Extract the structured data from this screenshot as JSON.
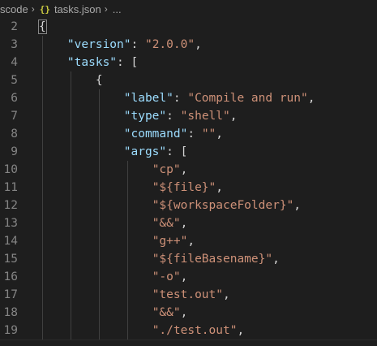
{
  "breadcrumb": {
    "folder": "scode",
    "file_icon": "{}",
    "file": "tasks.json",
    "ellipsis": "..."
  },
  "editor": {
    "lines": [
      {
        "n": "2",
        "tokens": [
          {
            "t": "{",
            "c": "punc"
          }
        ]
      },
      {
        "n": "3",
        "tokens": [
          {
            "t": "    "
          },
          {
            "t": "\"version\"",
            "c": "key"
          },
          {
            "t": ": "
          },
          {
            "t": "\"2.0.0\"",
            "c": "str"
          },
          {
            "t": ","
          }
        ]
      },
      {
        "n": "4",
        "tokens": [
          {
            "t": "    "
          },
          {
            "t": "\"tasks\"",
            "c": "key"
          },
          {
            "t": ": ["
          }
        ]
      },
      {
        "n": "5",
        "tokens": [
          {
            "t": "        {"
          }
        ]
      },
      {
        "n": "6",
        "tokens": [
          {
            "t": "            "
          },
          {
            "t": "\"label\"",
            "c": "key"
          },
          {
            "t": ": "
          },
          {
            "t": "\"Compile and run\"",
            "c": "str"
          },
          {
            "t": ","
          }
        ]
      },
      {
        "n": "7",
        "tokens": [
          {
            "t": "            "
          },
          {
            "t": "\"type\"",
            "c": "key"
          },
          {
            "t": ": "
          },
          {
            "t": "\"shell\"",
            "c": "str"
          },
          {
            "t": ","
          }
        ]
      },
      {
        "n": "8",
        "tokens": [
          {
            "t": "            "
          },
          {
            "t": "\"command\"",
            "c": "key"
          },
          {
            "t": ": "
          },
          {
            "t": "\"\"",
            "c": "str"
          },
          {
            "t": ","
          }
        ]
      },
      {
        "n": "9",
        "tokens": [
          {
            "t": "            "
          },
          {
            "t": "\"args\"",
            "c": "key"
          },
          {
            "t": ": ["
          }
        ]
      },
      {
        "n": "10",
        "tokens": [
          {
            "t": "                "
          },
          {
            "t": "\"cp\"",
            "c": "str"
          },
          {
            "t": ","
          }
        ]
      },
      {
        "n": "11",
        "tokens": [
          {
            "t": "                "
          },
          {
            "t": "\"${file}\"",
            "c": "str"
          },
          {
            "t": ","
          }
        ]
      },
      {
        "n": "12",
        "tokens": [
          {
            "t": "                "
          },
          {
            "t": "\"${workspaceFolder}\"",
            "c": "str"
          },
          {
            "t": ","
          }
        ]
      },
      {
        "n": "13",
        "tokens": [
          {
            "t": "                "
          },
          {
            "t": "\"&&\"",
            "c": "str"
          },
          {
            "t": ","
          }
        ]
      },
      {
        "n": "14",
        "tokens": [
          {
            "t": "                "
          },
          {
            "t": "\"g++\"",
            "c": "str"
          },
          {
            "t": ","
          }
        ]
      },
      {
        "n": "15",
        "tokens": [
          {
            "t": "                "
          },
          {
            "t": "\"${fileBasename}\"",
            "c": "str"
          },
          {
            "t": ","
          }
        ]
      },
      {
        "n": "16",
        "tokens": [
          {
            "t": "                "
          },
          {
            "t": "\"-o\"",
            "c": "str"
          },
          {
            "t": ","
          }
        ]
      },
      {
        "n": "17",
        "tokens": [
          {
            "t": "                "
          },
          {
            "t": "\"test.out\"",
            "c": "str"
          },
          {
            "t": ","
          }
        ]
      },
      {
        "n": "18",
        "tokens": [
          {
            "t": "                "
          },
          {
            "t": "\"&&\"",
            "c": "str"
          },
          {
            "t": ","
          }
        ]
      },
      {
        "n": "19",
        "tokens": [
          {
            "t": "                "
          },
          {
            "t": "\"./test.out\"",
            "c": "str"
          },
          {
            "t": ","
          }
        ]
      }
    ]
  },
  "colors": {
    "background": "#1e1e1e",
    "key": "#9cdcfe",
    "string": "#ce9178",
    "punctuation": "#d4d4d4",
    "line_number": "#858585",
    "json_icon": "#cbcb41"
  }
}
